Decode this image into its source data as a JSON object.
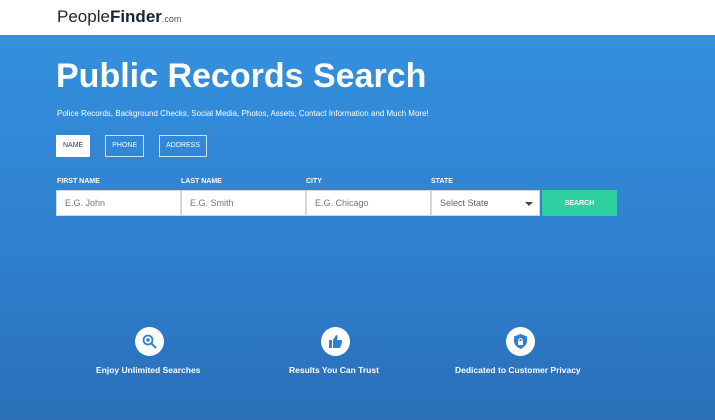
{
  "header": {
    "logo_people": "People",
    "logo_finder": "Finder",
    "logo_suffix": ".com"
  },
  "hero": {
    "title": "Public Records Search",
    "subtitle": "Police Records, Background Checks, Social Media, Photos, Assets, Contact Information and Much More!"
  },
  "tabs": [
    {
      "label": "NAME",
      "active": true
    },
    {
      "label": "PHONE",
      "active": false
    },
    {
      "label": "ADDRESS",
      "active": false
    }
  ],
  "form": {
    "first_name_label": "FIRST NAME",
    "last_name_label": "LAST NAME",
    "city_label": "CITY",
    "state_label": "STATE",
    "first_name_placeholder": "E.G. John",
    "last_name_placeholder": "E.G. Smith",
    "city_placeholder": "E.G. Chicago",
    "state_selected": "Select State",
    "search_label": "SEARCH"
  },
  "features": [
    {
      "label": "Enjoy Unlimited Searches",
      "icon": "magnifier-icon"
    },
    {
      "label": "Results You Can Trust",
      "icon": "thumbs-up-icon"
    },
    {
      "label": "Dedicated to Customer Privacy",
      "icon": "shield-lock-icon"
    }
  ],
  "colors": {
    "hero_blue": "#3490dd",
    "search_button": "#2fd0a0"
  }
}
